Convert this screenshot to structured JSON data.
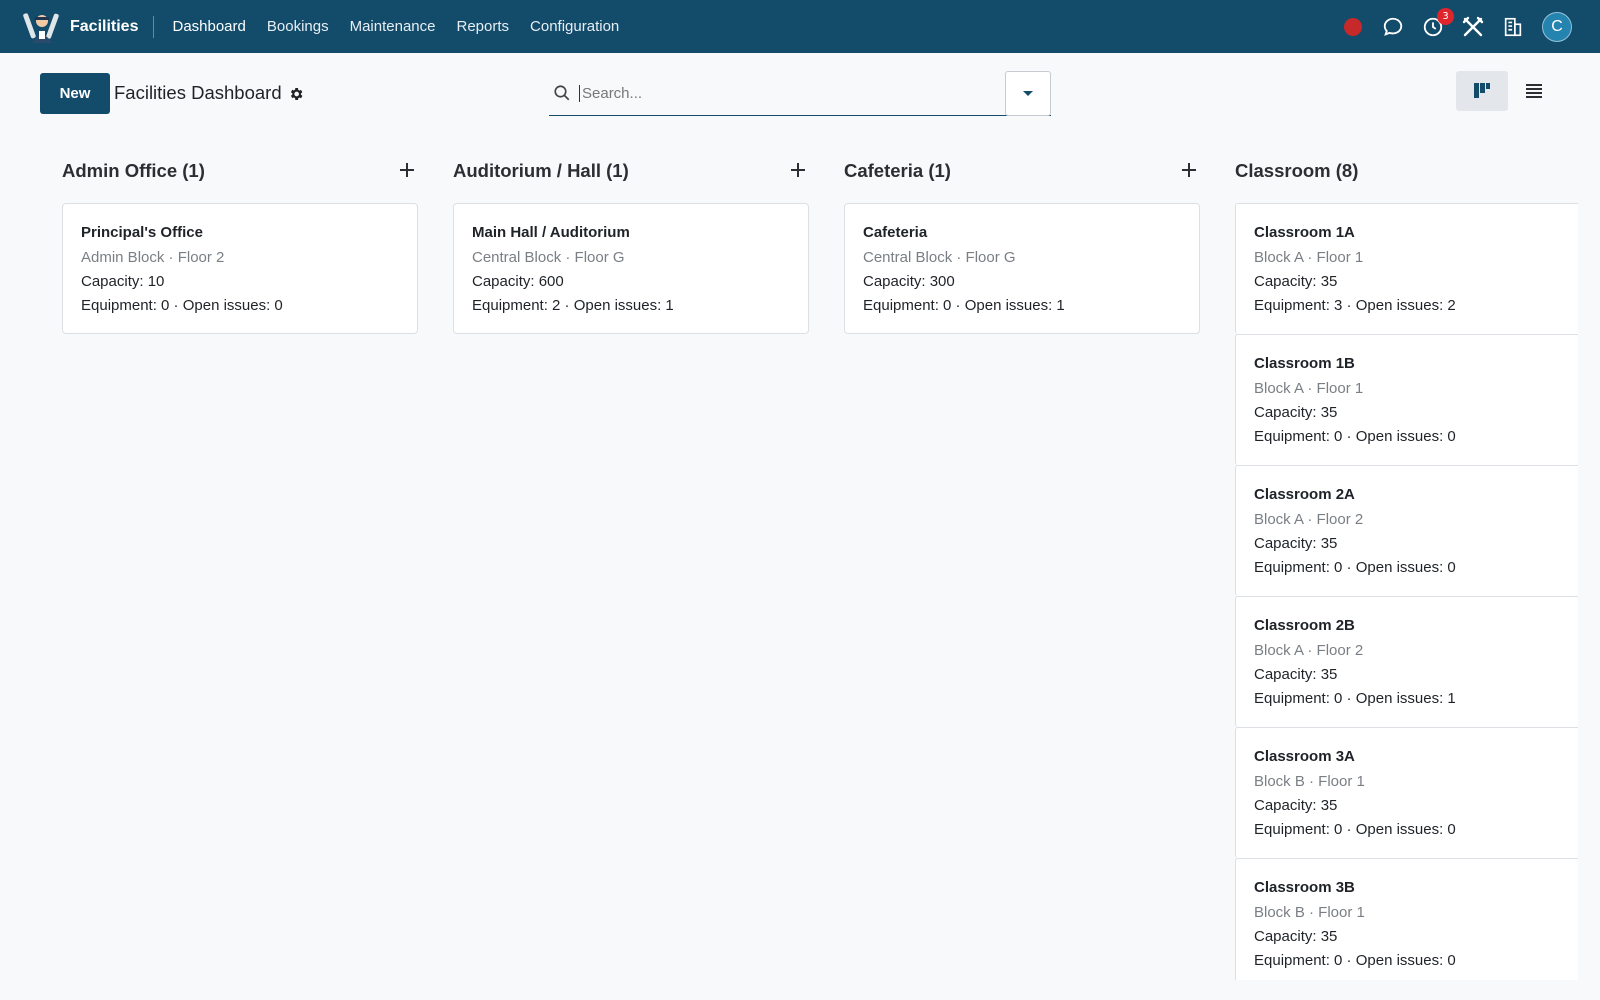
{
  "app": {
    "name": "Facilities",
    "colors": {
      "topbar": "#134b6b",
      "primary": "#134b6b",
      "record": "#c52929",
      "badge": "#e0242b",
      "avatar": "#2583b0"
    }
  },
  "nav": [
    {
      "label": "Dashboard",
      "active": true
    },
    {
      "label": "Bookings"
    },
    {
      "label": "Maintenance"
    },
    {
      "label": "Reports"
    },
    {
      "label": "Configuration"
    }
  ],
  "systray": {
    "activity_count": "3",
    "avatar_initial": "C",
    "icons": [
      "record-icon",
      "chat-icon",
      "clock-icon",
      "tools-icon",
      "building-icon"
    ]
  },
  "controls": {
    "new_label": "New",
    "page_title": "Facilities Dashboard",
    "search_placeholder": "Search..."
  },
  "columns": [
    {
      "title": "Admin Office (1)",
      "cards": [
        {
          "name": "Principal's Office",
          "location": "Admin Block · Floor 2",
          "capacity": "Capacity: 10",
          "stats": "Equipment: 0 · Open issues: 0"
        }
      ]
    },
    {
      "title": "Auditorium / Hall (1)",
      "cards": [
        {
          "name": "Main Hall / Auditorium",
          "location": "Central Block · Floor G",
          "capacity": "Capacity: 600",
          "stats": "Equipment: 2 · Open issues: 1"
        }
      ]
    },
    {
      "title": "Cafeteria (1)",
      "cards": [
        {
          "name": "Cafeteria",
          "location": "Central Block · Floor G",
          "capacity": "Capacity: 300",
          "stats": "Equipment: 0 · Open issues: 1"
        }
      ]
    },
    {
      "title": "Classroom (8)",
      "cards": [
        {
          "name": "Classroom 1A",
          "location": "Block A · Floor 1",
          "capacity": "Capacity: 35",
          "stats": "Equipment: 3 · Open issues: 2"
        },
        {
          "name": "Classroom 1B",
          "location": "Block A · Floor 1",
          "capacity": "Capacity: 35",
          "stats": "Equipment: 0 · Open issues: 0"
        },
        {
          "name": "Classroom 2A",
          "location": "Block A · Floor 2",
          "capacity": "Capacity: 35",
          "stats": "Equipment: 0 · Open issues: 0"
        },
        {
          "name": "Classroom 2B",
          "location": "Block A · Floor 2",
          "capacity": "Capacity: 35",
          "stats": "Equipment: 0 · Open issues: 1"
        },
        {
          "name": "Classroom 3A",
          "location": "Block B · Floor 1",
          "capacity": "Capacity: 35",
          "stats": "Equipment: 0 · Open issues: 0"
        },
        {
          "name": "Classroom 3B",
          "location": "Block B · Floor 1",
          "capacity": "Capacity: 35",
          "stats": "Equipment: 0 · Open issues: 0"
        }
      ]
    }
  ]
}
